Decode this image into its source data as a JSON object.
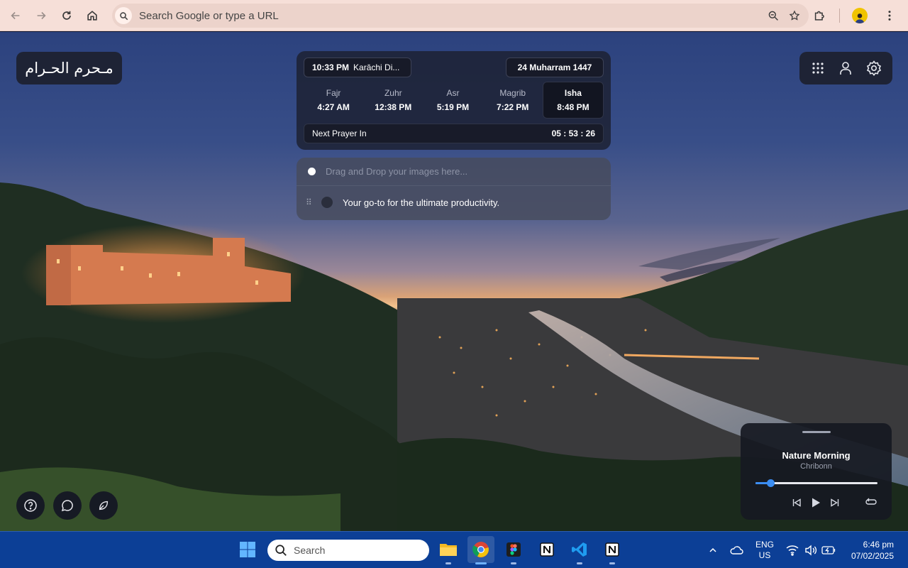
{
  "browser": {
    "omnibox_placeholder": "Search Google or type a URL",
    "icons": [
      "back-icon",
      "forward-icon",
      "reload-icon",
      "home-icon",
      "search-icon",
      "zoom-icon",
      "star-icon",
      "extensions-icon",
      "profile-avatar",
      "more-icon"
    ]
  },
  "logo": {
    "text": "مـحرم الحـرام"
  },
  "prayer": {
    "time": "10:33 PM",
    "city": "Karāchi Di...",
    "hijri_date": "24 Muharram 1447",
    "prayers": [
      {
        "name": "Fajr",
        "time": "4:27 AM"
      },
      {
        "name": "Zuhr",
        "time": "12:38 PM"
      },
      {
        "name": "Asr",
        "time": "5:19 PM"
      },
      {
        "name": "Magrib",
        "time": "7:22 PM"
      },
      {
        "name": "Isha",
        "time": "8:48 PM",
        "active": true
      }
    ],
    "next_label": "Next Prayer In",
    "countdown": "05 : 53 : 26"
  },
  "todo": {
    "placeholder": "Drag and Drop your images here...",
    "items": [
      {
        "text": "Your go-to for the ultimate productivity."
      }
    ]
  },
  "top_right_icons": [
    "apps-grid-icon",
    "user-icon",
    "settings-icon"
  ],
  "bottom_left_icons": [
    "help-icon",
    "chat-icon",
    "leaf-icon"
  ],
  "player": {
    "title": "Nature Morning",
    "artist": "Chribonn",
    "progress": 0.12,
    "accent": "#3b8df2"
  },
  "taskbar": {
    "search_label": "Search",
    "apps": [
      "file-explorer",
      "chrome",
      "figma",
      "notion",
      "vscode",
      "notion"
    ],
    "lang_line1": "ENG",
    "lang_line2": "US",
    "time": "6:46 pm",
    "date": "07/02/2025",
    "color": "#0c3f96"
  }
}
